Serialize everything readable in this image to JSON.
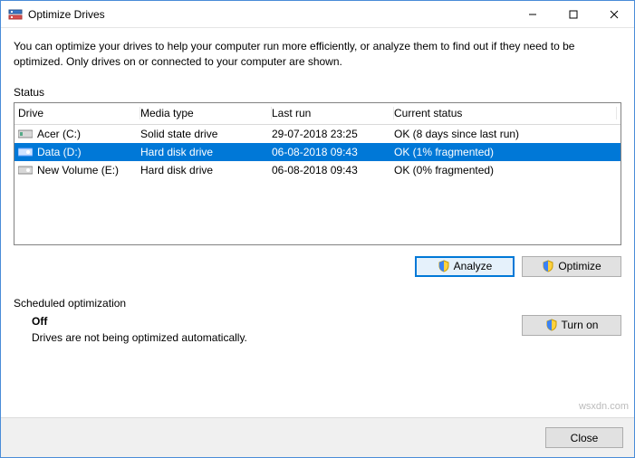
{
  "window": {
    "title": "Optimize Drives"
  },
  "intro": "You can optimize your drives to help your computer run more efficiently, or analyze them to find out if they need to be optimized. Only drives on or connected to your computer are shown.",
  "status_label": "Status",
  "columns": {
    "drive": "Drive",
    "media": "Media type",
    "last": "Last run",
    "status": "Current status"
  },
  "drives": [
    {
      "icon": "ssd",
      "name": "Acer (C:)",
      "media": "Solid state drive",
      "last": "29-07-2018 23:25",
      "status": "OK (8 days since last run)",
      "selected": false
    },
    {
      "icon": "hdd",
      "name": "Data (D:)",
      "media": "Hard disk drive",
      "last": "06-08-2018 09:43",
      "status": "OK (1% fragmented)",
      "selected": true
    },
    {
      "icon": "hdd",
      "name": "New Volume (E:)",
      "media": "Hard disk drive",
      "last": "06-08-2018 09:43",
      "status": "OK (0% fragmented)",
      "selected": false
    }
  ],
  "buttons": {
    "analyze": "Analyze",
    "optimize": "Optimize",
    "turn_on": "Turn on",
    "close": "Close"
  },
  "scheduled": {
    "section_label": "Scheduled optimization",
    "state": "Off",
    "desc": "Drives are not being optimized automatically."
  },
  "watermark": "wsxdn.com",
  "colors": {
    "selection": "#0078d7",
    "button_focus_bg": "#e5f1fb"
  }
}
